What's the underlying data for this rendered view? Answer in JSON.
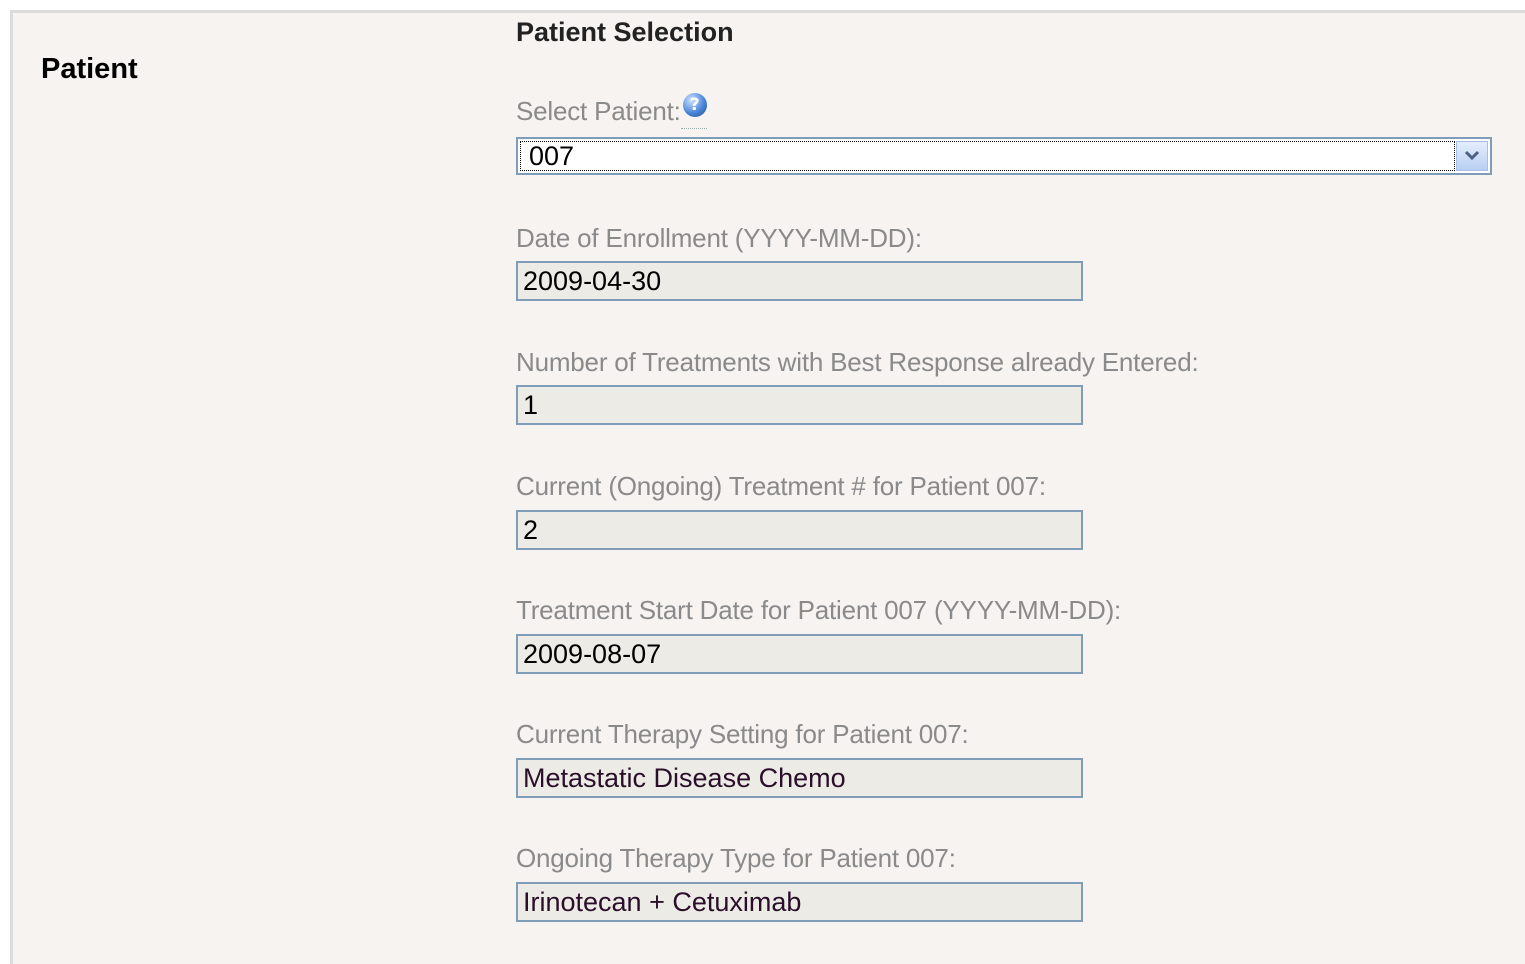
{
  "section": {
    "title": "Patient"
  },
  "form": {
    "heading": "Patient Selection",
    "select_patient": {
      "label": "Select Patient:",
      "help_icon": "help-question-icon",
      "value": "007",
      "arrow_icon": "chevron-down-icon"
    },
    "fields": [
      {
        "label": "Date of Enrollment (YYYY-MM-DD):",
        "value": "2009-04-30"
      },
      {
        "label": "Number of Treatments with Best Response already Entered:",
        "value": "1"
      },
      {
        "label": "Current (Ongoing) Treatment # for Patient 007:",
        "value": "2"
      },
      {
        "label": "Treatment Start Date for Patient 007 (YYYY-MM-DD):",
        "value": "2009-08-07"
      },
      {
        "label": "Current Therapy Setting for Patient 007:",
        "value": "Metastatic Disease Chemo"
      },
      {
        "label": "Ongoing Therapy Type for Patient 007:",
        "value": "Irinotecan + Cetuximab"
      }
    ]
  },
  "colors": {
    "panel_background": "#f6f3f1",
    "label_gray": "#8a8a8a",
    "field_background": "#ecebe5",
    "field_border": "#7f9db9"
  }
}
